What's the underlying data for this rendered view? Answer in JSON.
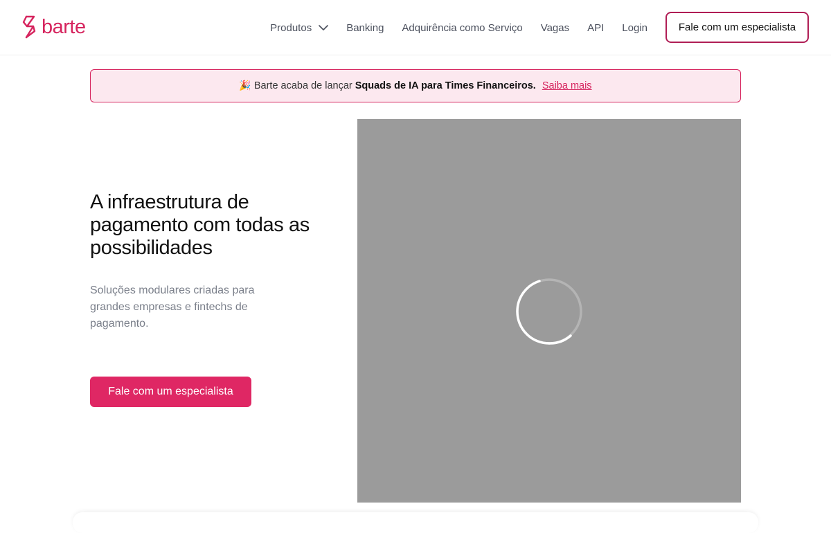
{
  "brand": {
    "name": "barte",
    "accent_color": "#d6245e",
    "logo_icon": "barte-logo-mark-icon"
  },
  "nav": {
    "items": [
      {
        "label": "Produtos",
        "has_dropdown": true
      },
      {
        "label": "Banking"
      },
      {
        "label": "Adquirência como Serviço"
      },
      {
        "label": "Vagas"
      },
      {
        "label": "API"
      },
      {
        "label": "Login"
      }
    ],
    "cta_label": "Fale com um especialista"
  },
  "banner": {
    "emoji": "🎉",
    "text": "Barte acaba de lançar",
    "highlight": "Squads de IA para Times Financeiros.",
    "link_label": "Saiba mais"
  },
  "hero": {
    "title": "A infraestrutura de pagamento com todas as possibilidades",
    "subtitle": "Soluções modulares criadas para grandes empresas e fintechs de pagamento.",
    "cta_label": "Fale com um especialista"
  },
  "media": {
    "state": "loading",
    "icon": "loading-spinner-icon",
    "background_color": "#9b9b9b"
  }
}
